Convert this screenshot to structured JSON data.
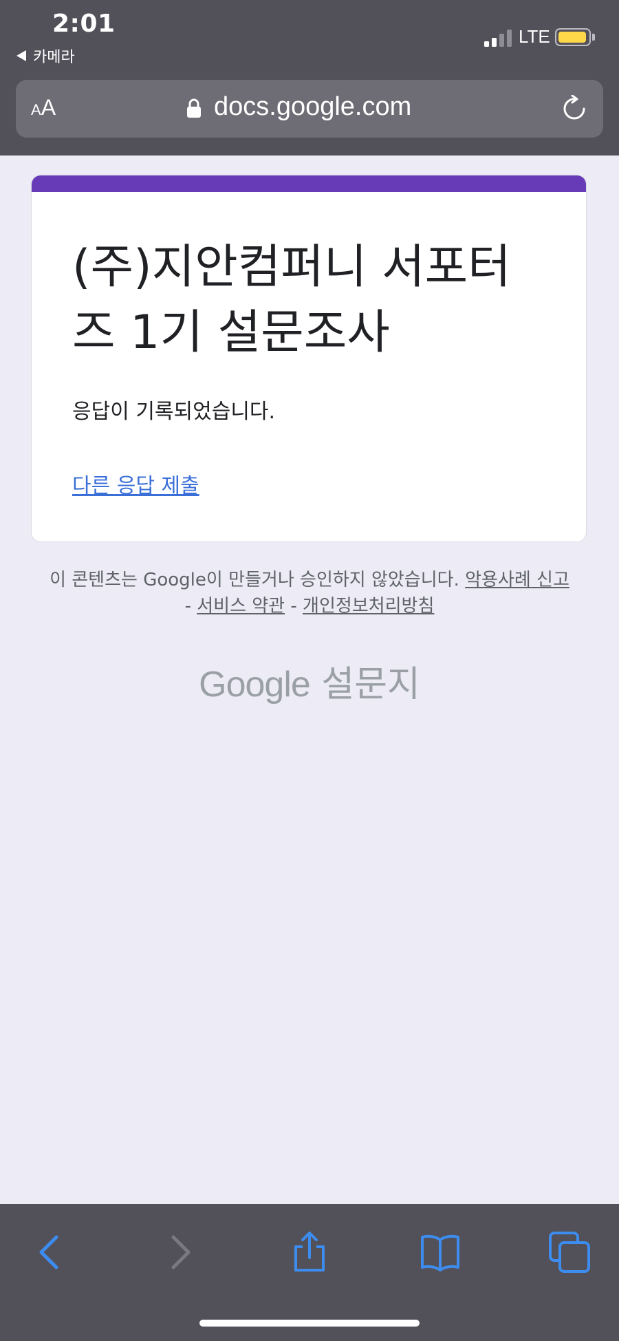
{
  "status_bar": {
    "time": "2:01",
    "back_app": "카메라",
    "network": "LTE",
    "battery_color": "#ffd84a"
  },
  "browser": {
    "text_size_small": "A",
    "text_size_large": "A",
    "domain": "docs.google.com"
  },
  "form": {
    "accent_color": "#673ab7",
    "title": "(주)지안컴퍼니 서포터즈 1기 설문조사",
    "confirmation": "응답이 기록되었습니다.",
    "resubmit_link": "다른 응답 제출",
    "link_color": "#3a6fd8"
  },
  "footer": {
    "disclaimer_text": "이 콘텐츠는 Google이 만들거나 승인하지 않았습니다.",
    "report_abuse": "악용사례 신고",
    "separator": "-",
    "terms": "서비스 약관",
    "privacy": "개인정보처리방침",
    "brand_google": "Google",
    "brand_forms": "설문지"
  },
  "toolbar": {
    "icons": [
      "back-icon",
      "forward-icon",
      "share-icon",
      "bookmarks-icon",
      "tabs-icon"
    ],
    "active_color": "#3d8cf0",
    "disabled_color": "#7a7982"
  }
}
